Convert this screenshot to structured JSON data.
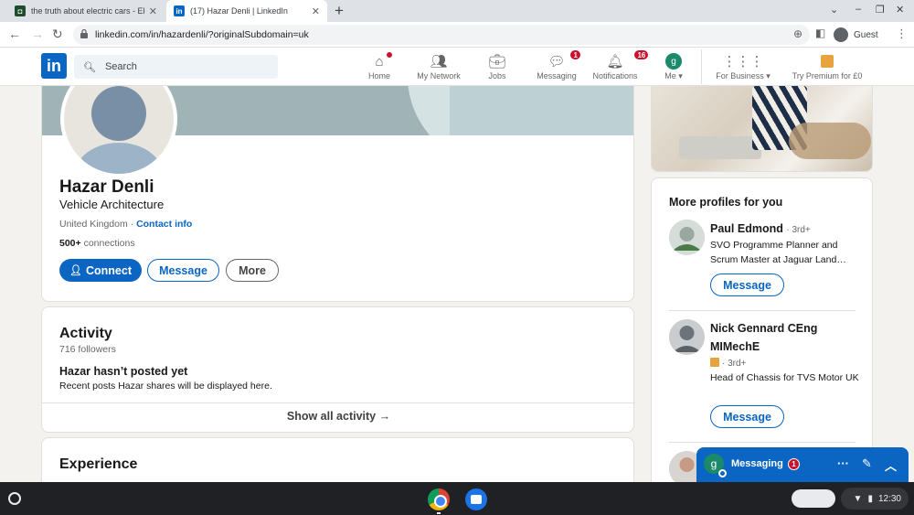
{
  "browser": {
    "tabs": [
      {
        "title": "the truth about electric cars - Ele",
        "favicon": "green-square-icon"
      },
      {
        "title": "(17) Hazar Denli | LinkedIn",
        "favicon": "linkedin-icon"
      }
    ],
    "new_tab": "+",
    "url": "linkedin.com/in/hazardenli/?originalSubdomain=uk",
    "profile_label": "Guest"
  },
  "linkedin_nav": {
    "logo": "in",
    "search_placeholder": "Search",
    "items": [
      {
        "label": "Home",
        "icon": "home-icon",
        "badge": ""
      },
      {
        "label": "My Network",
        "icon": "people-icon",
        "badge": ""
      },
      {
        "label": "Jobs",
        "icon": "briefcase-icon",
        "badge": ""
      },
      {
        "label": "Messaging",
        "icon": "chat-icon",
        "badge": "1"
      },
      {
        "label": "Notifications",
        "icon": "bell-icon",
        "badge": "16"
      },
      {
        "label": "Me",
        "icon": "avatar-icon",
        "badge": ""
      }
    ],
    "me_initial": "g",
    "for_business": "For Business",
    "premium": "Try Premium for £0"
  },
  "profile": {
    "name": "Hazar Denli",
    "headline": "Vehicle Architecture",
    "location": "United Kingdom",
    "contact_info": "Contact info",
    "connections_count": "500+",
    "connections_label": "connections",
    "buttons": {
      "connect": "Connect",
      "message": "Message",
      "more": "More"
    }
  },
  "activity": {
    "title": "Activity",
    "followers": "716 followers",
    "no_posts_title": "Hazar hasn’t posted yet",
    "no_posts_desc": "Recent posts Hazar shares will be displayed here.",
    "show_all": "Show all activity →"
  },
  "experience": {
    "title": "Experience"
  },
  "more_profiles": {
    "title": "More profiles for you",
    "people": [
      {
        "name": "Paul Edmond",
        "degree": "· 3rd+",
        "headline": "SVO Programme Planner and Scrum Master at Jaguar Land…",
        "button": "Message"
      },
      {
        "name": "Nick Gennard CEng MIMechE",
        "degree": "· 3rd+",
        "headline": "Head of Chassis for TVS Motor UK",
        "button": "Message"
      }
    ]
  },
  "messaging_widget": {
    "initial": "g",
    "label": "Messaging",
    "badge": "1"
  },
  "system": {
    "time": "12:30"
  },
  "colors": {
    "accent": "#0a66c2",
    "badge": "#cb112d"
  }
}
